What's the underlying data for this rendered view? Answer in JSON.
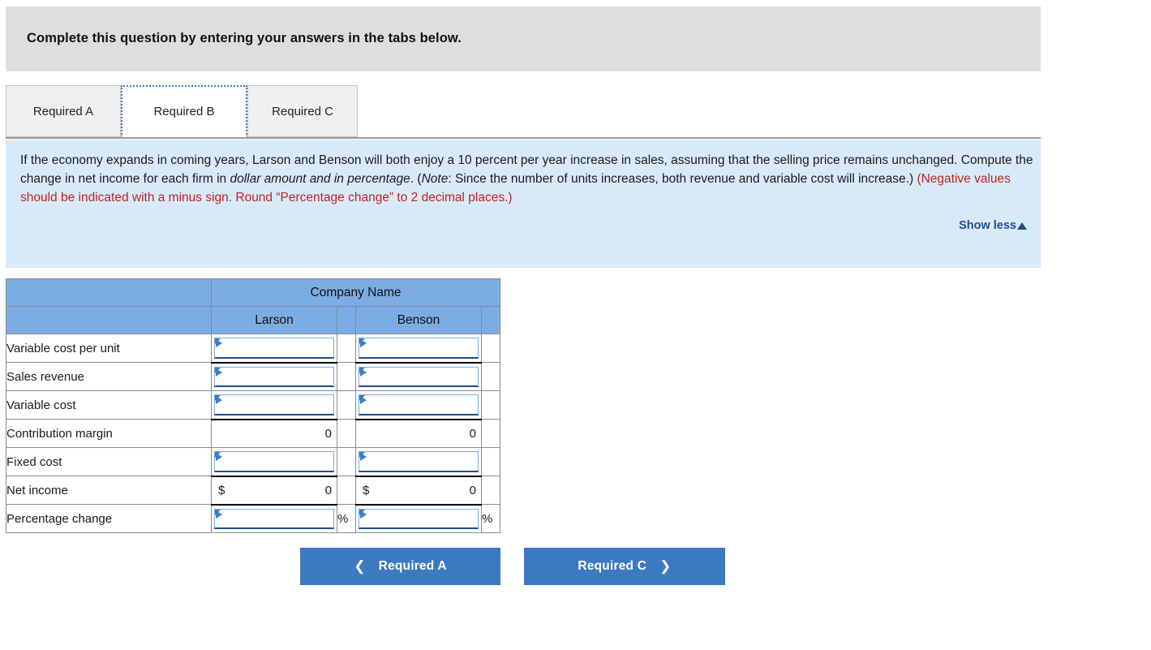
{
  "header": {
    "banner_text": "Complete this question by entering your answers in the tabs below."
  },
  "tabs": [
    {
      "id": "required-a",
      "label": "Required A",
      "active": false
    },
    {
      "id": "required-b",
      "label": "Required B",
      "active": true
    },
    {
      "id": "required-c",
      "label": "Required C",
      "active": false
    }
  ],
  "question": {
    "part1": "If the economy expands in coming years, Larson and Benson will both enjoy a 10 percent per year increase in sales, assuming that the selling price remains unchanged. Compute the change in net income for each firm in ",
    "italic1": "dollar amount and in percentage",
    "part2": ". (",
    "italic2": "Note",
    "part3": ": Since the number of units increases, both revenue and variable cost will increase.) ",
    "red": "(Negative values should be indicated with a minus sign. Round “Percentage change” to 2 decimal places.)",
    "show_less_label": "Show less"
  },
  "table": {
    "group_header": "Company Name",
    "columns": [
      "Larson",
      "Benson"
    ],
    "rows": [
      {
        "label": "Variable cost per unit",
        "type": "input",
        "larson": "",
        "benson": "",
        "unit": "",
        "currency": ""
      },
      {
        "label": "Sales revenue",
        "type": "input",
        "larson": "",
        "benson": "",
        "unit": "",
        "currency": ""
      },
      {
        "label": "Variable cost",
        "type": "input",
        "larson": "",
        "benson": "",
        "unit": "",
        "currency": ""
      },
      {
        "label": "Contribution margin",
        "type": "static",
        "larson": "0",
        "benson": "0",
        "unit": "",
        "currency": ""
      },
      {
        "label": "Fixed cost",
        "type": "input",
        "larson": "",
        "benson": "",
        "unit": "",
        "currency": ""
      },
      {
        "label": "Net income",
        "type": "static",
        "larson": "0",
        "benson": "0",
        "unit": "",
        "currency": "$"
      },
      {
        "label": "Percentage change",
        "type": "input",
        "larson": "",
        "benson": "",
        "unit": "%",
        "currency": ""
      }
    ]
  },
  "nav": {
    "prev_label": "Required A",
    "next_label": "Required C",
    "prev_icon": "❮",
    "next_icon": "❯"
  },
  "colors": {
    "banner_gray": "#dedede",
    "panel_blue": "#d8eafa",
    "header_blue": "#7cace4",
    "accent_blue": "#3b7ac0",
    "link_blue": "#1f4e88",
    "warning_red": "#c0241f"
  }
}
